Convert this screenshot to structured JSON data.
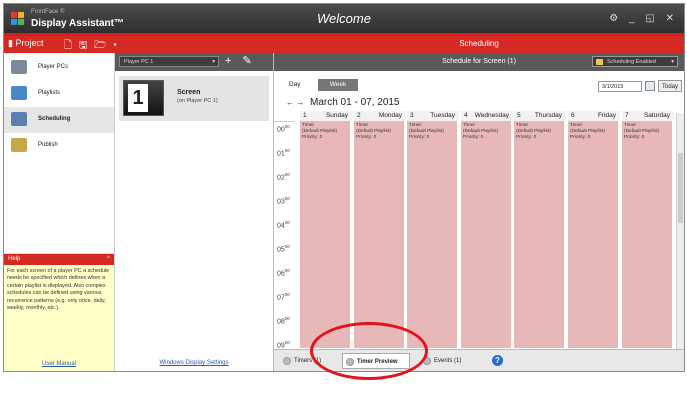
{
  "app": {
    "brand_small": "FrontFace ®",
    "brand_name": "Display Assistant™",
    "window_title": "Welcome",
    "window_controls": "⚙ _ ◱ ✕"
  },
  "menu": {
    "project_label": "Project",
    "project_tools": "🗋 🖫 🗁 ▾",
    "section_title": "Scheduling"
  },
  "nav": {
    "items": [
      {
        "label": "Player PCs",
        "icon": "monitor-icon",
        "color": "#7a8a9a"
      },
      {
        "label": "Playlists",
        "icon": "playlist-icon",
        "color": "#4a86c8"
      },
      {
        "label": "Scheduling",
        "icon": "calendar-icon",
        "color": "#5b7fb0",
        "active": true
      },
      {
        "label": "Publish",
        "icon": "publish-icon",
        "color": "#c9a64a"
      }
    ]
  },
  "help": {
    "title": "Help",
    "collapse": "^",
    "text": "For each screen of a player PC a schedule needs be specified which defines when a certain playlist is displayed. Also complex schedules can be defined using various recurrence patterns (e.g. only once, daily, weekly, monthly, etc.).",
    "link": "User Manual"
  },
  "player": {
    "selected": "Player PC 1",
    "actions": "+ ✎ —",
    "screen_number": "1",
    "screen_name": "Screen",
    "screen_sub": "(on Player PC 1)",
    "settings_link": "Windows Display Settings"
  },
  "schedule": {
    "header": "Schedule for Screen (1)",
    "enabled_label": "Scheduling Enabled",
    "tab_day": "Day",
    "tab_week": "Week",
    "date_value": "3/1/2015",
    "today_label": "Today",
    "nav_arrows": "← →",
    "range_label": "March 01 - 07, 2015",
    "days": [
      {
        "num": "1",
        "name": "Sunday"
      },
      {
        "num": "2",
        "name": "Monday"
      },
      {
        "num": "3",
        "name": "Tuesday"
      },
      {
        "num": "4",
        "name": "Wednesday"
      },
      {
        "num": "5",
        "name": "Thursday"
      },
      {
        "num": "6",
        "name": "Friday"
      },
      {
        "num": "7",
        "name": "Saturday"
      }
    ],
    "event": {
      "line1": "Timer",
      "line2": "(Default Playlist)",
      "line3": "Priority: 0"
    },
    "hours": [
      "00",
      "01",
      "02",
      "03",
      "04",
      "05",
      "06",
      "07",
      "08",
      "09"
    ],
    "minutes": "00",
    "event_color": "#e8b8b8"
  },
  "bottom_tabs": {
    "timers": "Timers (1)",
    "timer_preview": "Timer Preview",
    "events": "Events (1)",
    "help": "?"
  }
}
